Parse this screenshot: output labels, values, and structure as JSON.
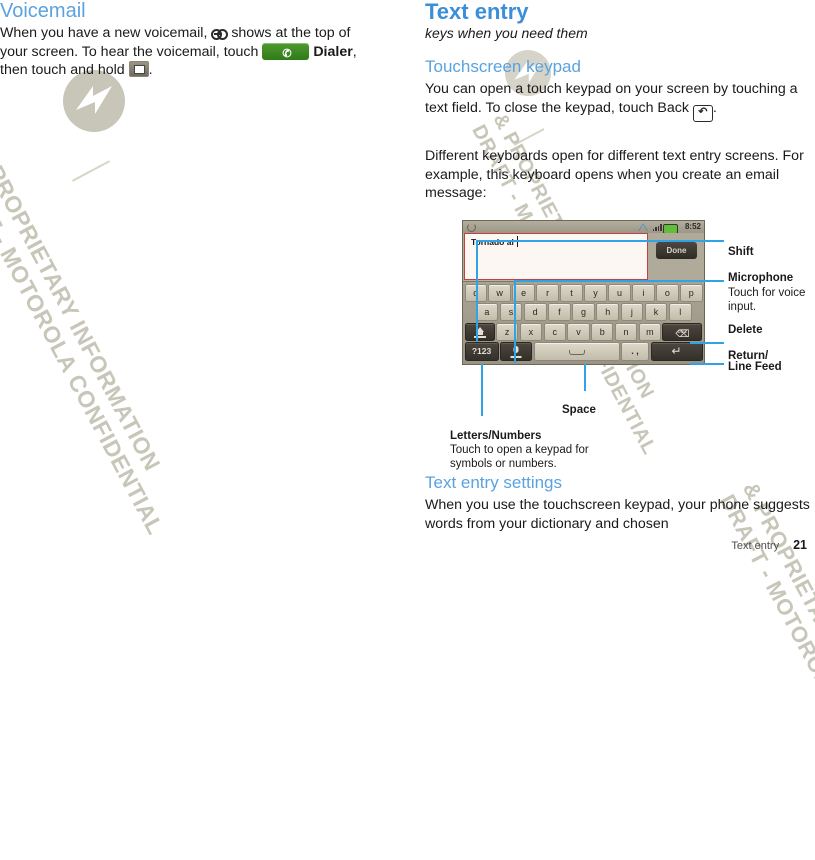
{
  "watermark": {
    "line1": "DRAFT - MOTOROLA CONFIDENTIAL",
    "line2": "& PROPRIETARY INFORMATION",
    "logo_icon": "motorola-m-logo"
  },
  "left_column": {
    "heading": "Voicemail",
    "paragraph_part1": "When you have a new voicemail,",
    "voicemail_icon": "voicemail-tape-icon",
    "paragraph_part2": "shows at the top of your screen. To hear the voicemail, touch",
    "dialer_button_icon": "phone-handset-icon",
    "dialer_label": "Dialer",
    "paragraph_part3": ", then touch and hold",
    "voicemail_key_icon": "voicemail-envelope-key-icon",
    "paragraph_part4": "."
  },
  "right_column": {
    "heading": "Text entry",
    "subtitle": "keys when you need them",
    "section1": {
      "heading": "Touchscreen keypad",
      "paragraph1_part1": "You can open a touch keypad on your screen by touching a text field. To close the keypad, touch Back",
      "back_icon": "back-arrow-icon",
      "paragraph1_part2": ".",
      "paragraph2": "Different keyboards open for different text entry screens. For example, this keyboard opens when you create an email message:"
    },
    "section2": {
      "heading": "Text entry settings",
      "paragraph": "When you use the touchscreen keypad, your phone suggests words from your dictionary and chosen"
    }
  },
  "screenshot": {
    "statusbar": {
      "left_icon": "sync-icon",
      "alert_icon": "warning-triangle-icon",
      "signal_icon": "signal-bars-icon",
      "battery_icon": "battery-full-icon",
      "clock": "8:52"
    },
    "compose": {
      "field_value": "Tornado al",
      "done_label": "Done"
    },
    "keyboard": {
      "row1": [
        "q",
        "w",
        "e",
        "r",
        "t",
        "y",
        "u",
        "i",
        "o",
        "p"
      ],
      "row2": [
        "a",
        "s",
        "d",
        "f",
        "g",
        "h",
        "j",
        "k",
        "l"
      ],
      "row3_letters": [
        "z",
        "x",
        "c",
        "v",
        "b",
        "n",
        "m"
      ],
      "shift_icon": "shift-arrow-icon",
      "delete_label": "DEL",
      "delete_icon": "backspace-icon",
      "symbols_label": "?123",
      "mic_icon": "microphone-icon",
      "space_icon": "space-bar-icon",
      "comma_label": ". ,",
      "enter_icon": "return-arrow-icon"
    }
  },
  "callouts": [
    {
      "title": "Shift",
      "desc": ""
    },
    {
      "title": "Microphone",
      "desc": "Touch for voice input."
    },
    {
      "title": "Delete",
      "desc": ""
    },
    {
      "title": "Return/",
      "title2": "Line Feed",
      "desc": ""
    },
    {
      "title": "Space",
      "desc": ""
    },
    {
      "title": "Letters/Numbers",
      "desc": "Touch to open a keypad for symbols or numbers."
    }
  ],
  "footer": {
    "section": "Text entry",
    "page": "21"
  },
  "colors": {
    "heading_blue": "#5aa2e0",
    "title_blue": "#3b8fd9",
    "callout_blue": "#2fa2e8",
    "watermark_gray": "#c8c6b8",
    "dialer_green": "#3f8a24",
    "field_red": "#c2413f"
  }
}
